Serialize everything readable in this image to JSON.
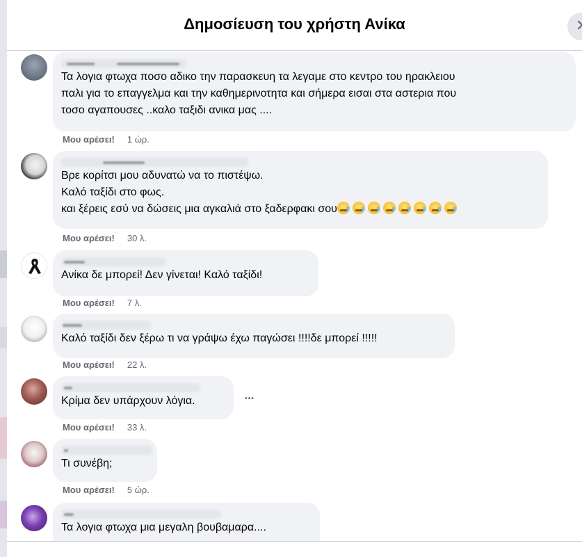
{
  "dialog": {
    "title": "Δημοσίευση του χρήστη Ανίκα",
    "close_glyph": "✕"
  },
  "comments": [
    {
      "text": "Τα λογια φτωχα ποσο αδικο την παρασκευη τα λεγαμε στο κεντρο του ηρακλειου\nπαλι για το επαγγελμα και την καθημερινοτητα και σήμερα εισαι στα αστερια που\nτοσο αγαπουσες ..καλο ταξιδι ανικα μας ....",
      "like": "Μου αρέσει!",
      "time": "1 ώρ."
    },
    {
      "text_lines": [
        "Βρε κορίτσι μου αδυνατώ να το πιστέψω.",
        "Καλό ταξίδι στο φως.",
        "και ξέρεις εσύ να δώσεις μια αγκαλιά στο ξαδερφακι σου"
      ],
      "emoji_name": "crying-face-emoji",
      "emoji_count": 8,
      "like": "Μου αρέσει!",
      "time": "30 λ."
    },
    {
      "text": "Ανίκα δε μπορεί! Δεν γίνεται! Καλό ταξίδι!",
      "like": "Μου αρέσει!",
      "time": "7 λ."
    },
    {
      "text": "Καλό ταξίδι δεν ξέρω τι να γράψω έχω παγώσει !!!!δε μπορεί !!!!!",
      "like": "Μου αρέσει!",
      "time": "22 λ."
    },
    {
      "text": "Κρίμα δεν υπάρχουν λόγια.",
      "like": "Μου αρέσει!",
      "time": "33 λ.",
      "more_glyph": "•••"
    },
    {
      "text": "Τι συνέβη;",
      "like": "Μου αρέσει!",
      "time": "5 ώρ."
    },
    {
      "text": "Τα λογια φτωχα μια μεγαλη βουβαμαρα...."
    }
  ],
  "colors": {
    "bubble": "#f0f2f5",
    "meta": "#65676b",
    "divider": "#ced0d4"
  }
}
